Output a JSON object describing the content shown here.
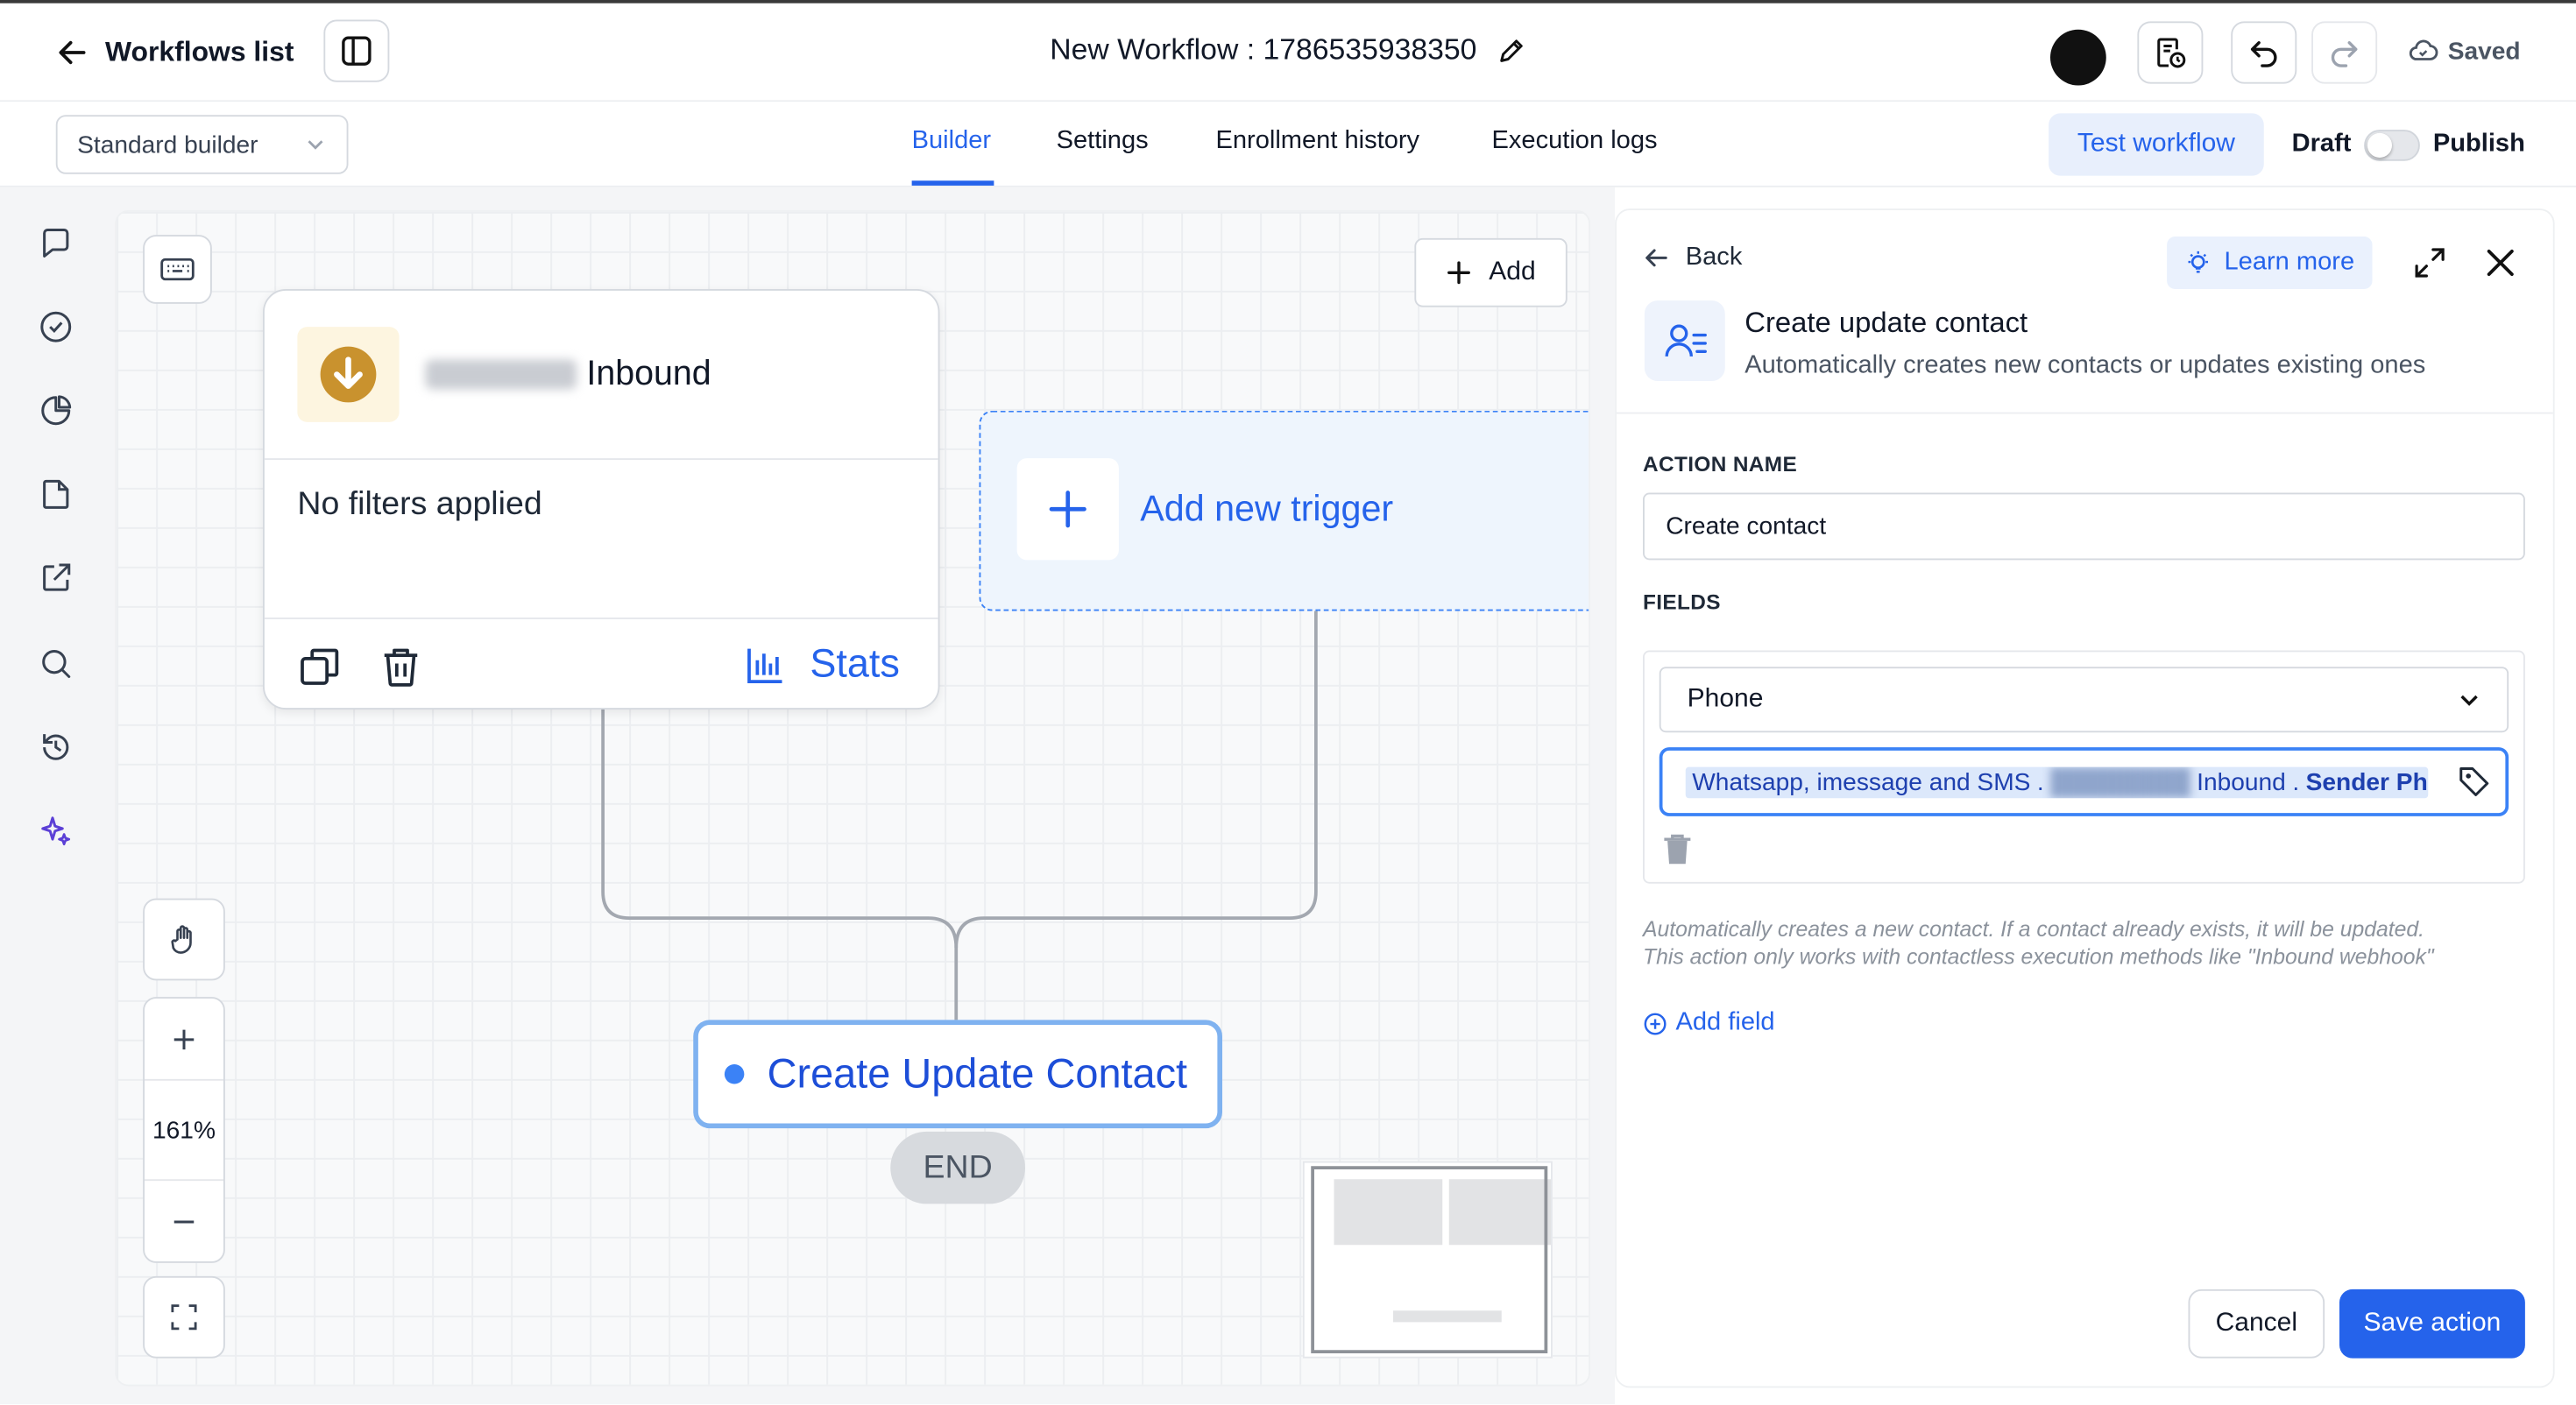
{
  "header": {
    "back_label": "Workflows list",
    "workflow_title": "New Workflow : 1786535938350",
    "status_label": "Saved"
  },
  "subheader": {
    "builder_mode": "Standard builder",
    "tabs": [
      {
        "label": "Builder",
        "active": true
      },
      {
        "label": "Settings",
        "active": false
      },
      {
        "label": "Enrollment history",
        "active": false
      },
      {
        "label": "Execution logs",
        "active": false
      }
    ],
    "test_label": "Test workflow",
    "draft_label": "Draft",
    "publish_label": "Publish",
    "publish_on": false
  },
  "sidebar": {
    "icons": [
      "message-icon",
      "check-circle-icon",
      "pie-chart-icon",
      "file-icon",
      "external-link-icon",
      "search-icon",
      "history-icon",
      "sparkles-icon"
    ]
  },
  "canvas": {
    "add_label": "Add",
    "zoom_level": "161%",
    "trigger": {
      "name_suffix": "Inbound",
      "filters_text": "No filters applied",
      "stats_label": "Stats"
    },
    "new_trigger_label": "Add new trigger",
    "action_label": "Create Update Contact",
    "end_label": "END"
  },
  "panel": {
    "back_label": "Back",
    "learn_more_label": "Learn more",
    "action_title": "Create update contact",
    "action_subtitle": "Automatically creates new contacts or updates existing ones",
    "action_name_caption": "ACTION NAME",
    "action_name_value": "Create contact",
    "fields_caption": "FIELDS",
    "field_select": "Phone",
    "field_value": {
      "seg1": "Whatsapp, imessage and SMS",
      "seg3": "Inbound",
      "seg4": "Sender Ph"
    },
    "help_line1": "Automatically creates a new contact. If a contact already exists, it will be updated.",
    "help_line2": "This action only works with contactless execution methods like \"Inbound webhook\"",
    "add_field_label": "Add field",
    "cancel_label": "Cancel",
    "save_label": "Save action"
  },
  "colors": {
    "accent": "#2563eb",
    "trigger_icon": "#c9922e",
    "canvas_bg": "#f8f9fa"
  }
}
